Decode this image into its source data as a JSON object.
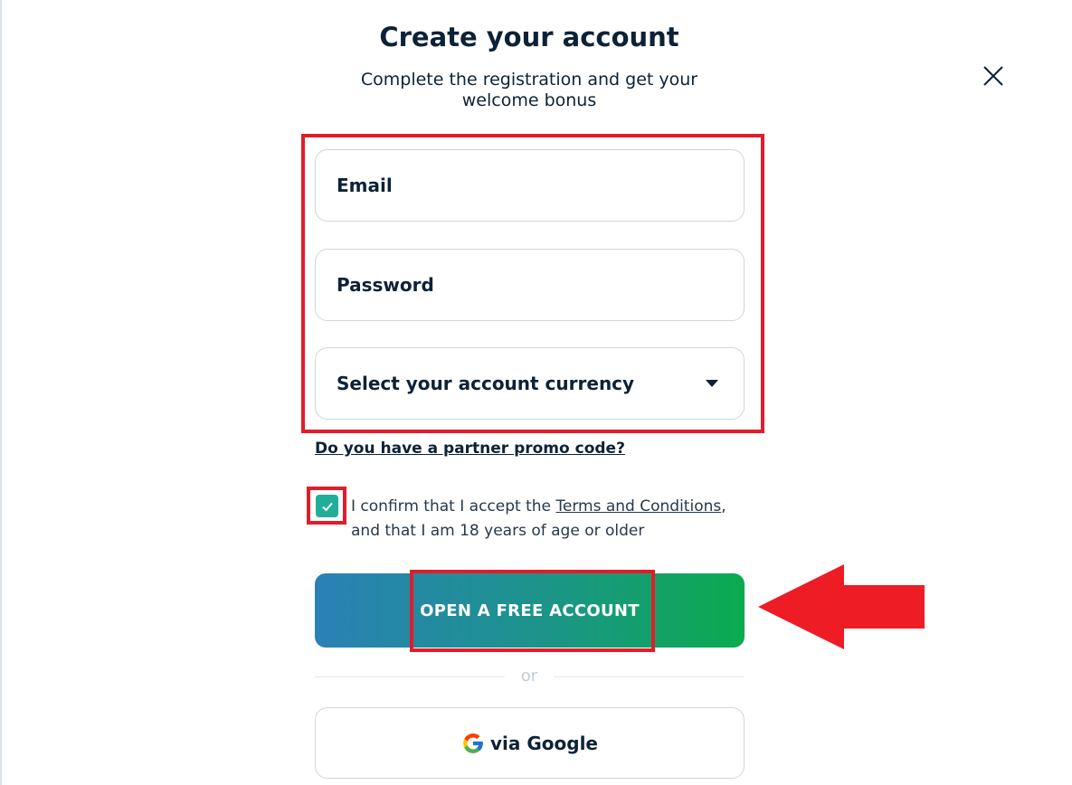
{
  "modal": {
    "title": "Create your account",
    "subtitle": "Complete the registration and get your welcome bonus"
  },
  "form": {
    "email_placeholder": "Email",
    "password_placeholder": "Password",
    "currency_label": "Select your account currency",
    "promo_link": "Do you have a partner promo code?",
    "consent": {
      "checked": true,
      "text_before": "I confirm that I accept the ",
      "terms_link": "Terms and Conditions",
      "text_after": ", and that I am 18 years of age or older"
    },
    "submit_label": "OPEN A FREE ACCOUNT",
    "separator": "or",
    "google_label": "via Google"
  },
  "icons": {
    "close": "close-icon",
    "dropdown": "chevron-down-icon",
    "checkbox": "check-icon",
    "google": "google-icon",
    "annotation": "arrow-left-icon"
  },
  "colors": {
    "text": "#0d2237",
    "checkbox": "#1fae98",
    "cta_gradient_start": "#2a81b6",
    "cta_gradient_end": "#0bab4f",
    "annotation_red": "#e11d2a"
  }
}
